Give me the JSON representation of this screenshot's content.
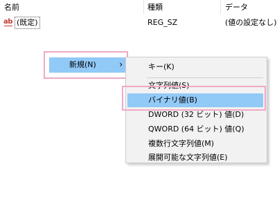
{
  "columns": {
    "name": "名前",
    "type": "種類",
    "data": "データ"
  },
  "value_row": {
    "icon": "registry-string-icon",
    "icon_text": "ab",
    "name": "(既定)",
    "type": "REG_SZ",
    "data": "(値の設定なし)"
  },
  "context_menu": {
    "new_label": "新規(N)",
    "arrow": "›"
  },
  "submenu": {
    "items": [
      "キー(K)",
      "文字列値(S)",
      "バイナリ値(B)",
      "DWORD (32 ビット) 値(D)",
      "QWORD (64 ビット) 値(Q)",
      "複数行文字列値(M)",
      "展開可能な文字列値(E)"
    ]
  },
  "colors": {
    "highlight": "#91c9f7",
    "annotation_frame": "#f0a8c4",
    "menu_bg": "#f2f2f2"
  }
}
